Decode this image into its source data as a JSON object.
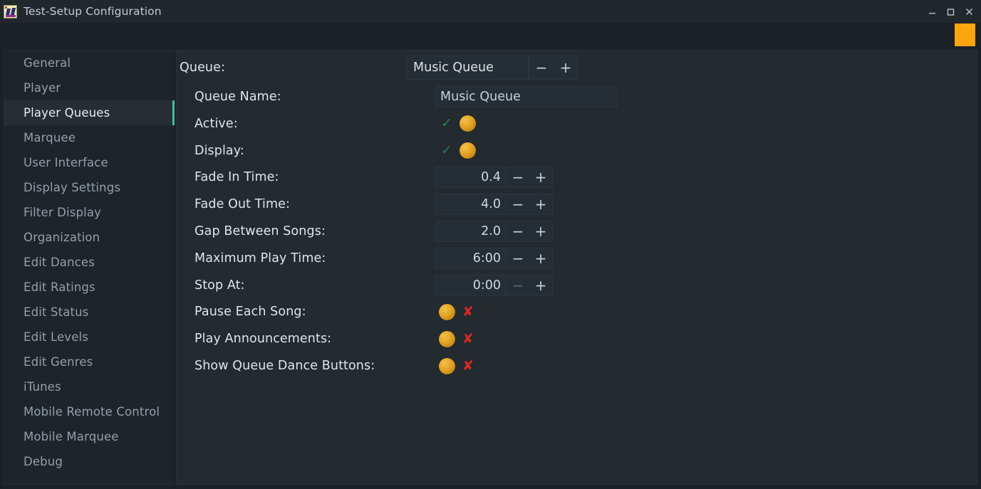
{
  "window": {
    "title": "Test-Setup Configuration",
    "icon": "app-icon",
    "controls": {
      "minimize": "minimize-icon",
      "maximize": "maximize-icon",
      "close": "close-icon"
    }
  },
  "accent": {
    "selection_bar": "#3cbf9b",
    "knob_orange": "#e3a323",
    "check_green": "#2e7d4f",
    "cross_red": "#d42a22",
    "marker_square": "#fda50f"
  },
  "sidebar": {
    "items": [
      {
        "label": "General",
        "selected": false
      },
      {
        "label": "Player",
        "selected": false
      },
      {
        "label": "Player Queues",
        "selected": true
      },
      {
        "label": "Marquee",
        "selected": false
      },
      {
        "label": "User Interface",
        "selected": false
      },
      {
        "label": "Display Settings",
        "selected": false
      },
      {
        "label": "Filter Display",
        "selected": false
      },
      {
        "label": "Organization",
        "selected": false
      },
      {
        "label": "Edit Dances",
        "selected": false
      },
      {
        "label": "Edit Ratings",
        "selected": false
      },
      {
        "label": "Edit Status",
        "selected": false
      },
      {
        "label": "Edit Levels",
        "selected": false
      },
      {
        "label": "Edit Genres",
        "selected": false
      },
      {
        "label": "iTunes",
        "selected": false
      },
      {
        "label": "Mobile Remote Control",
        "selected": false
      },
      {
        "label": "Mobile Marquee",
        "selected": false
      },
      {
        "label": "Debug",
        "selected": false
      }
    ]
  },
  "main": {
    "queue_header": {
      "label": "Queue:",
      "selected_queue": "Music Queue",
      "minus_label": "−",
      "plus_label": "+"
    },
    "rows": [
      {
        "label": "Queue Name:",
        "type": "text",
        "value": "Music Queue"
      },
      {
        "label": "Active:",
        "type": "toggle",
        "state": "on",
        "mark": "✓"
      },
      {
        "label": "Display:",
        "type": "toggle",
        "state": "on",
        "mark": "✓"
      },
      {
        "label": "Fade In Time:",
        "type": "spinner",
        "value": "0.4",
        "minus_label": "−",
        "plus_label": "+",
        "minus_dim": false
      },
      {
        "label": "Fade Out Time:",
        "type": "spinner",
        "value": "4.0",
        "minus_label": "−",
        "plus_label": "+",
        "minus_dim": false
      },
      {
        "label": "Gap Between Songs:",
        "type": "spinner",
        "value": "2.0",
        "minus_label": "−",
        "plus_label": "+",
        "minus_dim": false
      },
      {
        "label": "Maximum Play Time:",
        "type": "spinner",
        "value": "6:00",
        "minus_label": "−",
        "plus_label": "+",
        "minus_dim": false
      },
      {
        "label": "Stop At:",
        "type": "spinner",
        "value": "0:00",
        "minus_label": "−",
        "plus_label": "+",
        "minus_dim": true
      },
      {
        "label": "Pause Each Song:",
        "type": "toggle",
        "state": "off",
        "mark": "✘"
      },
      {
        "label": "Play Announcements:",
        "type": "toggle",
        "state": "off",
        "mark": "✘"
      },
      {
        "label": "Show Queue Dance Buttons:",
        "type": "toggle",
        "state": "off",
        "mark": "✘"
      }
    ]
  }
}
